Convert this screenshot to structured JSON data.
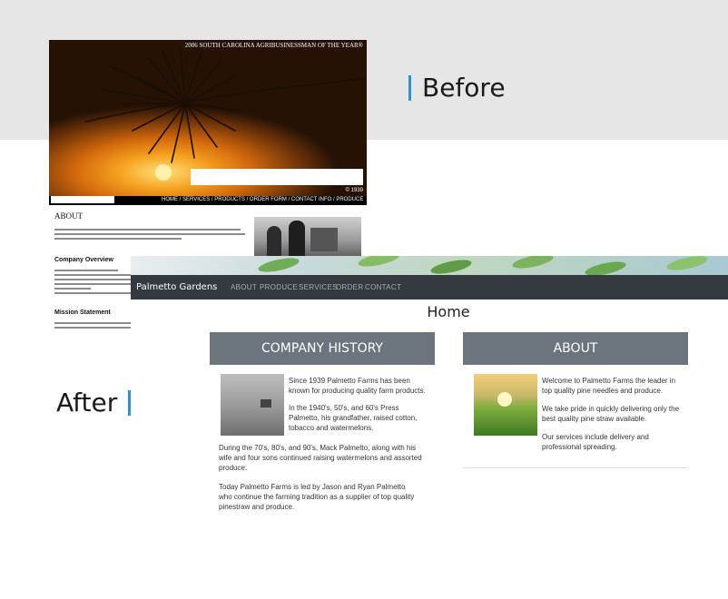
{
  "labels": {
    "before": "Before",
    "after": "After"
  },
  "colors": {
    "accent": "#2a93d5",
    "navbar": "#343a40",
    "card_header": "#6c757d"
  },
  "before": {
    "award_tag": "2006 SOUTH CAROLINA AGRIBUSINESSMAN OF THE YEAR®",
    "copyright": "© 1939",
    "nav": "HOME / SERVICES / PRODUCTS / ORDER FORM / CONTACT INFO / PRODUCE",
    "about_heading": "ABOUT",
    "company_heading": "Company Overview",
    "mission_heading": "Mission Statement"
  },
  "after": {
    "brand": "Palmetto Gardens",
    "nav": [
      "ABOUT",
      "PRODUCE",
      "SERVICES",
      "ORDER",
      "CONTACT"
    ],
    "page_title": "Home",
    "history": {
      "title": "COMPANY HISTORY",
      "p1": "Since 1939 Palmetto Farms has been known for producing quality farm products.",
      "p2": "In the 1940's, 50's, and 60's Press Palmetto, his grandfather, raised cotton, tobacco and watermelons.",
      "p3": "During the 70's, 80's, and 90's, Mack Palmetto, along with his wife and four sons continued raising watermelons and assorted produce.",
      "p4": "Today Palmetto Farms is led by Jason and Ryan Palmetto who continue the farming tradition as a supplier of top quality pinestraw and produce."
    },
    "about": {
      "title": "ABOUT",
      "p1": "Welcome to Palmetto Farms the leader in top quality pine needles and produce.",
      "p2": "We take pride in quickly delivering only the best quality pine straw available.",
      "p3": "Our services include delivery and professional spreading."
    }
  }
}
